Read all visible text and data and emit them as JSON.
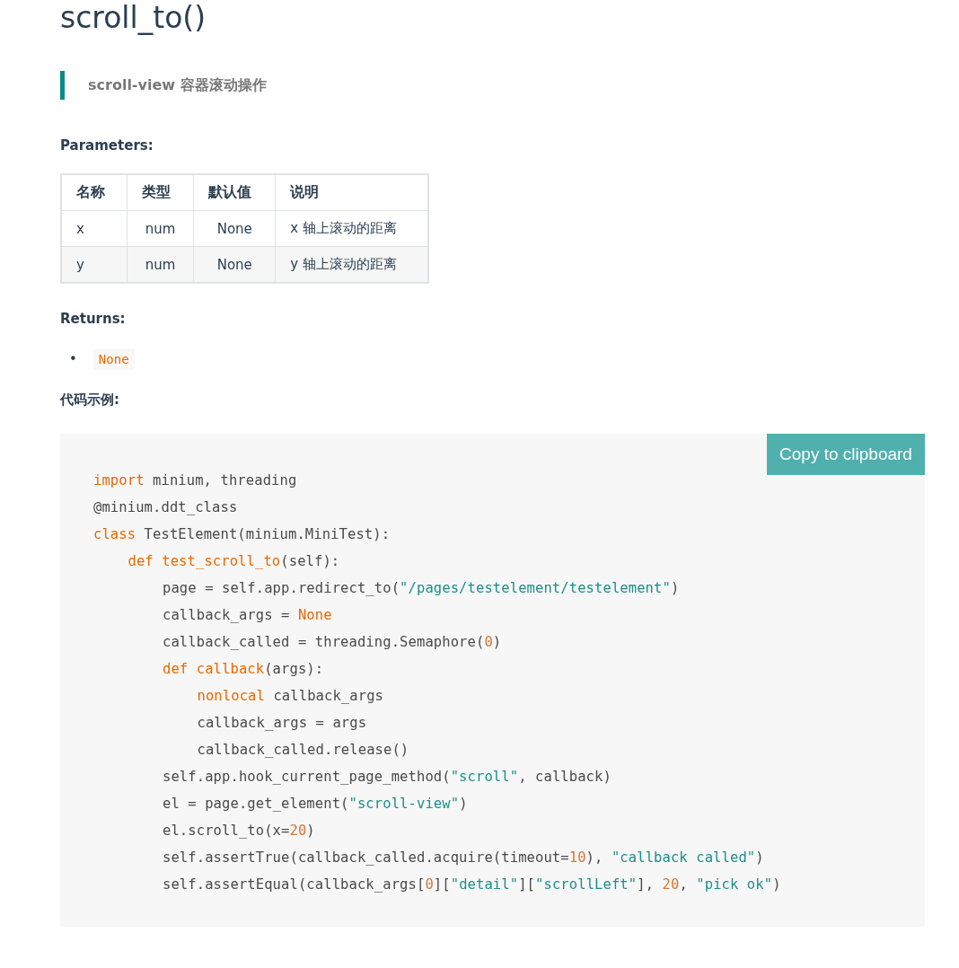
{
  "title": "scroll_to()",
  "summary": "scroll-view 容器滚动操作",
  "parameters": {
    "heading": "Parameters:",
    "columns": [
      "名称",
      "类型",
      "默认值",
      "说明"
    ],
    "rows": [
      [
        "x",
        "num",
        "None",
        "x 轴上滚动的距离"
      ],
      [
        "y",
        "num",
        "None",
        "y 轴上滚动的距离"
      ]
    ]
  },
  "returns": {
    "heading": "Returns:",
    "items": [
      {
        "marker": "•",
        "code": "None"
      }
    ]
  },
  "example": {
    "heading": "代码示例:",
    "copy_button": "Copy to clipboard",
    "lines": [
      {
        "tokens": [
          {
            "kind": "keyword",
            "text": "import"
          },
          {
            "kind": "plain",
            "text": " minium, threading"
          }
        ]
      },
      {
        "tokens": [
          {
            "kind": "plain",
            "text": "@minium.ddt_class"
          }
        ]
      },
      {
        "tokens": [
          {
            "kind": "keyword",
            "text": "class"
          },
          {
            "kind": "plain",
            "text": " TestElement(minium.MiniTest):"
          }
        ],
        "children": [
          {
            "tokens": [
              {
                "kind": "keyword",
                "text": "def"
              },
              {
                "kind": "function",
                "text": " test_scroll_to"
              },
              {
                "kind": "plain",
                "text": "(self):"
              }
            ],
            "children": [
              {
                "tokens": [
                  {
                    "kind": "plain",
                    "text": "page = self.app.redirect_to("
                  },
                  {
                    "kind": "string",
                    "text": "\"/pages/testelement/testelement\""
                  },
                  {
                    "kind": "plain",
                    "text": ")"
                  }
                ]
              },
              {
                "tokens": [
                  {
                    "kind": "plain",
                    "text": "callback_args = "
                  },
                  {
                    "kind": "keyword",
                    "text": "None"
                  }
                ]
              },
              {
                "tokens": [
                  {
                    "kind": "plain",
                    "text": "callback_called = threading.Semaphore("
                  },
                  {
                    "kind": "number",
                    "text": "0"
                  },
                  {
                    "kind": "plain",
                    "text": ")"
                  }
                ]
              },
              {
                "tokens": [
                  {
                    "kind": "keyword",
                    "text": "def"
                  },
                  {
                    "kind": "function",
                    "text": " callback"
                  },
                  {
                    "kind": "plain",
                    "text": "(args):"
                  }
                ],
                "children": [
                  {
                    "tokens": [
                      {
                        "kind": "keyword",
                        "text": "nonlocal"
                      },
                      {
                        "kind": "plain",
                        "text": " callback_args"
                      }
                    ]
                  },
                  {
                    "tokens": [
                      {
                        "kind": "plain",
                        "text": "callback_args = args"
                      }
                    ]
                  },
                  {
                    "tokens": [
                      {
                        "kind": "plain",
                        "text": "callback_called.release()"
                      }
                    ]
                  }
                ]
              },
              {
                "tokens": [
                  {
                    "kind": "plain",
                    "text": "self.app.hook_current_page_method("
                  },
                  {
                    "kind": "string",
                    "text": "\"scroll\""
                  },
                  {
                    "kind": "plain",
                    "text": ", callback)"
                  }
                ]
              },
              {
                "tokens": [
                  {
                    "kind": "plain",
                    "text": "el = page.get_element("
                  },
                  {
                    "kind": "string",
                    "text": "\"scroll-view\""
                  },
                  {
                    "kind": "plain",
                    "text": ")"
                  }
                ]
              },
              {
                "tokens": [
                  {
                    "kind": "plain",
                    "text": "el.scroll_to(x="
                  },
                  {
                    "kind": "number",
                    "text": "20"
                  },
                  {
                    "kind": "plain",
                    "text": ")"
                  }
                ]
              },
              {
                "tokens": [
                  {
                    "kind": "plain",
                    "text": "self.assertTrue(callback_called.acquire(timeout="
                  },
                  {
                    "kind": "number",
                    "text": "10"
                  },
                  {
                    "kind": "plain",
                    "text": "), "
                  },
                  {
                    "kind": "string",
                    "text": "\"callback called\""
                  },
                  {
                    "kind": "plain",
                    "text": ")"
                  }
                ]
              },
              {
                "tokens": [
                  {
                    "kind": "plain",
                    "text": "self.assertEqual(callback_args["
                  },
                  {
                    "kind": "number",
                    "text": "0"
                  },
                  {
                    "kind": "plain",
                    "text": "]["
                  },
                  {
                    "kind": "string",
                    "text": "\"detail\""
                  },
                  {
                    "kind": "plain",
                    "text": "]["
                  },
                  {
                    "kind": "string",
                    "text": "\"scrollLeft\""
                  },
                  {
                    "kind": "plain",
                    "text": "], "
                  },
                  {
                    "kind": "number",
                    "text": "20"
                  },
                  {
                    "kind": "plain",
                    "text": ", "
                  },
                  {
                    "kind": "string",
                    "text": "\"pick ok\""
                  },
                  {
                    "kind": "plain",
                    "text": ")"
                  }
                ]
              }
            ]
          }
        ]
      }
    ]
  }
}
